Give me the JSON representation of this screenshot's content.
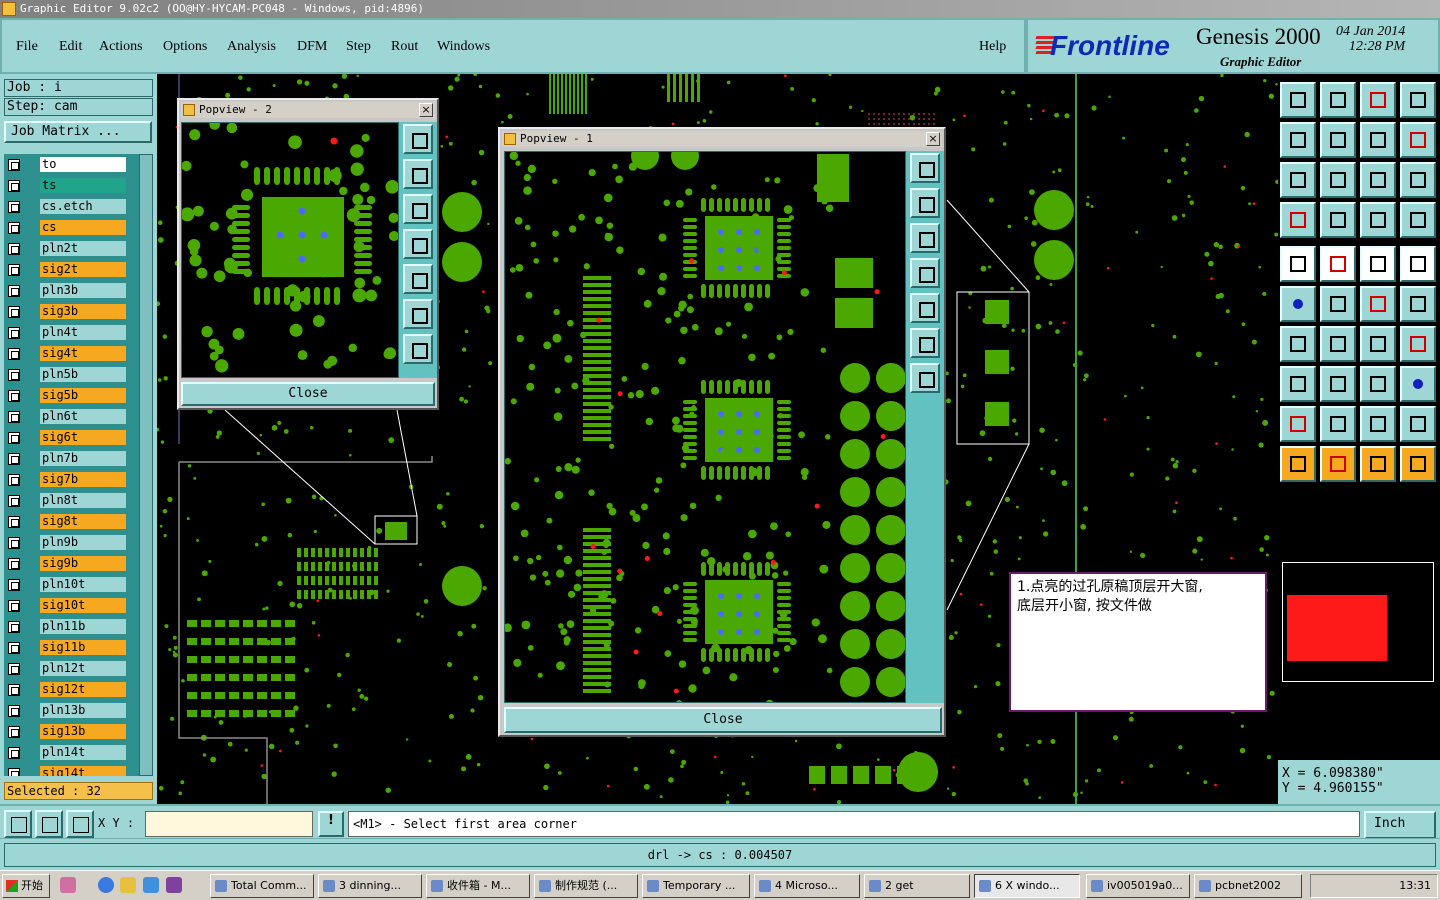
{
  "window": {
    "title": "Graphic Editor 9.02c2 (OO@HY-HYCAM-PC048 - Windows, pid:4896)"
  },
  "menu": {
    "items": [
      "File",
      "Edit",
      "Actions",
      "Options",
      "Analysis",
      "DFM",
      "Step",
      "Rout",
      "Windows"
    ],
    "help": "Help"
  },
  "brand": {
    "logo": "Frontline",
    "product": "Genesis 2000",
    "subtitle": "Graphic Editor",
    "date": "04 Jan 2014",
    "time": "12:28 PM"
  },
  "job": {
    "job_label": "Job : i",
    "step_label": "Step: cam",
    "matrix_button": "Job Matrix ..."
  },
  "layers": [
    {
      "name": "to",
      "color": "#ffffff"
    },
    {
      "name": "ts",
      "color": "#21a58a"
    },
    {
      "name": "cs.etch",
      "color": "#9ed6d6"
    },
    {
      "name": "cs",
      "color": "#f5a820"
    },
    {
      "name": "pln2t",
      "color": "#9ed6d6"
    },
    {
      "name": "sig2t",
      "color": "#f5a820"
    },
    {
      "name": "pln3b",
      "color": "#9ed6d6"
    },
    {
      "name": "sig3b",
      "color": "#f5a820"
    },
    {
      "name": "pln4t",
      "color": "#9ed6d6"
    },
    {
      "name": "sig4t",
      "color": "#f5a820"
    },
    {
      "name": "pln5b",
      "color": "#9ed6d6"
    },
    {
      "name": "sig5b",
      "color": "#f5a820"
    },
    {
      "name": "pln6t",
      "color": "#9ed6d6"
    },
    {
      "name": "sig6t",
      "color": "#f5a820"
    },
    {
      "name": "pln7b",
      "color": "#9ed6d6"
    },
    {
      "name": "sig7b",
      "color": "#f5a820"
    },
    {
      "name": "pln8t",
      "color": "#9ed6d6"
    },
    {
      "name": "sig8t",
      "color": "#f5a820"
    },
    {
      "name": "pln9b",
      "color": "#9ed6d6"
    },
    {
      "name": "sig9b",
      "color": "#f5a820"
    },
    {
      "name": "pln10t",
      "color": "#9ed6d6"
    },
    {
      "name": "sig10t",
      "color": "#f5a820"
    },
    {
      "name": "pln11b",
      "color": "#9ed6d6"
    },
    {
      "name": "sig11b",
      "color": "#f5a820"
    },
    {
      "name": "pln12t",
      "color": "#9ed6d6"
    },
    {
      "name": "sig12t",
      "color": "#f5a820"
    },
    {
      "name": "pln13b",
      "color": "#9ed6d6"
    },
    {
      "name": "sig13b",
      "color": "#f5a820"
    },
    {
      "name": "pln14t",
      "color": "#9ed6d6"
    },
    {
      "name": "sig14t",
      "color": "#f5a820"
    }
  ],
  "selected": "Selected : 32",
  "popview2": {
    "title": "Popview - 2",
    "close": "Close"
  },
  "popview1": {
    "title": "Popview - 1",
    "close": "Close"
  },
  "annotation": {
    "line1": "1.点亮的过孔原稿顶层开大窗,",
    "line2": "底层开小窗, 按文件做"
  },
  "coords": {
    "x": "X = 6.098380\"",
    "y": "Y = 4.960155\""
  },
  "command": {
    "xy_label": "X Y :",
    "xy_value": "",
    "warn": "!",
    "prompt": "<M1> - Select first area corner",
    "unit": "Inch"
  },
  "status": "drl -> cs : 0.004507",
  "colors": {
    "copper": "#4aa800",
    "via_blue": "#4a6aff",
    "drill_red": "#ff1a1a",
    "panel": "#9ed6d6"
  },
  "taskbar": {
    "start": "开始",
    "tasks": [
      {
        "label": "Total Comm...",
        "active": false
      },
      {
        "label": "3 dinning...",
        "active": false
      },
      {
        "label": "收件箱 - M...",
        "active": false
      },
      {
        "label": "制作规范 (...",
        "active": false
      },
      {
        "label": "Temporary ...",
        "active": false
      },
      {
        "label": "4 Microso...",
        "active": false
      },
      {
        "label": "2 get",
        "active": false
      },
      {
        "label": "6 X windo...",
        "active": true
      },
      {
        "label": "iv005019a0...",
        "active": false
      },
      {
        "label": "pcbnet2002",
        "active": false
      }
    ],
    "clock": "13:31"
  }
}
